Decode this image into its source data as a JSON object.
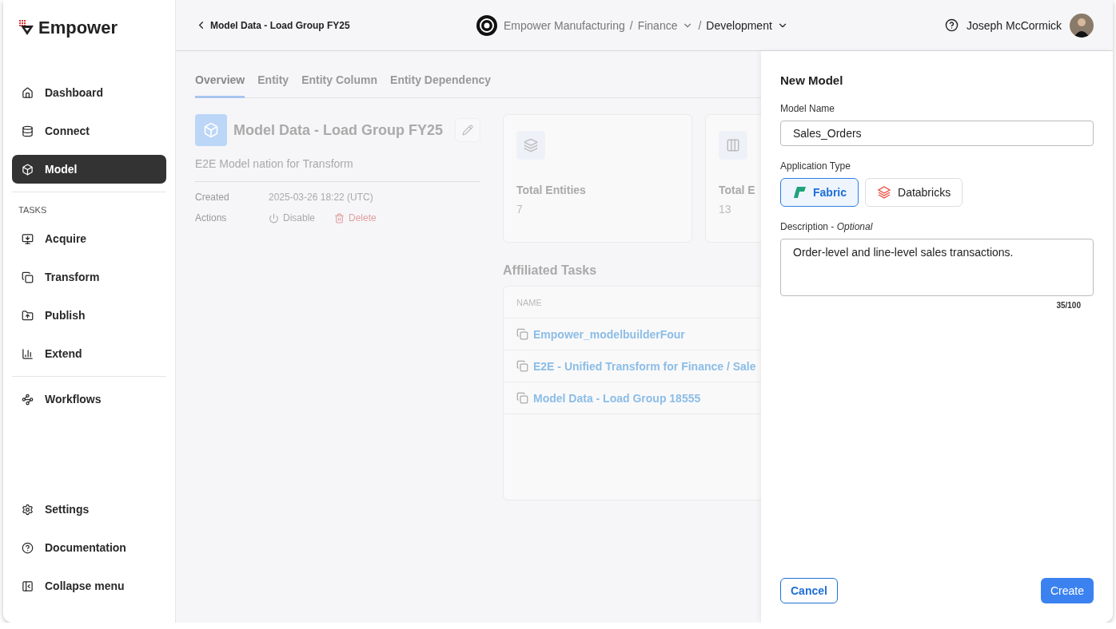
{
  "sidebar": {
    "brand": "Empower",
    "items": [
      {
        "kind": "nav",
        "label": "Dashboard",
        "selected": false
      },
      {
        "kind": "nav",
        "label": "Connect",
        "selected": false
      },
      {
        "kind": "nav",
        "label": "Model",
        "selected": true
      },
      {
        "kind": "divider"
      },
      {
        "kind": "section",
        "label": "TASKS"
      },
      {
        "kind": "nav",
        "label": "Acquire",
        "selected": false
      },
      {
        "kind": "nav",
        "label": "Transform",
        "selected": false
      },
      {
        "kind": "nav",
        "label": "Publish",
        "selected": false
      },
      {
        "kind": "nav",
        "label": "Extend",
        "selected": false
      },
      {
        "kind": "divider"
      },
      {
        "kind": "nav",
        "label": "Workflows",
        "selected": false
      }
    ],
    "bottom_items": [
      {
        "label": "Settings"
      },
      {
        "label": "Documentation"
      },
      {
        "label": "Collapse menu"
      }
    ]
  },
  "header": {
    "back": "Model Data - Load Group FY25",
    "separator": "/",
    "breadcrumbs": [
      {
        "label": "Empower Manufacturing",
        "dropdown": false,
        "current": false
      },
      {
        "label": "Finance",
        "dropdown": true,
        "current": false
      },
      {
        "label": "Development",
        "dropdown": true,
        "current": true
      }
    ],
    "user": "Joseph McCormick"
  },
  "tabs": [
    {
      "label": "Overview",
      "selected": true
    },
    {
      "label": "Entity",
      "selected": false
    },
    {
      "label": "Entity Column",
      "selected": false
    },
    {
      "label": "Entity Dependency",
      "selected": false
    }
  ],
  "model": {
    "title": "Model Data - Load Group FY25",
    "description": "E2E Model nation for Transform",
    "meta": [
      {
        "label": "Created",
        "value": "2025-03-26 18:22 (UTC)"
      }
    ],
    "actions_label": "Actions",
    "actions": [
      {
        "kind": "disable",
        "label": "Disable"
      },
      {
        "kind": "delete",
        "label": "Delete"
      }
    ]
  },
  "stats": [
    {
      "label": "Total Entities",
      "value": "7"
    },
    {
      "label": "Total E",
      "value": "13"
    }
  ],
  "affiliated": {
    "title": "Affiliated Tasks",
    "column": "NAME",
    "rows": [
      "Empower_modelbuilderFour",
      "E2E - Unified Transform for Finance / Sale",
      "Model Data - Load Group 18555"
    ]
  },
  "drawer": {
    "title": "New Model",
    "name_label": "Model Name",
    "name_value": "Sales_Orders",
    "type_label": "Application Type",
    "types": [
      {
        "kind": "fabric",
        "label": "Fabric",
        "selected": true
      },
      {
        "kind": "databricks",
        "label": "Databricks",
        "selected": false
      }
    ],
    "description_label": "Description - *Optional*",
    "description_value": "Order-level and line-level sales transactions.",
    "counter": "35/100",
    "cancel": "Cancel",
    "create": "Create"
  }
}
